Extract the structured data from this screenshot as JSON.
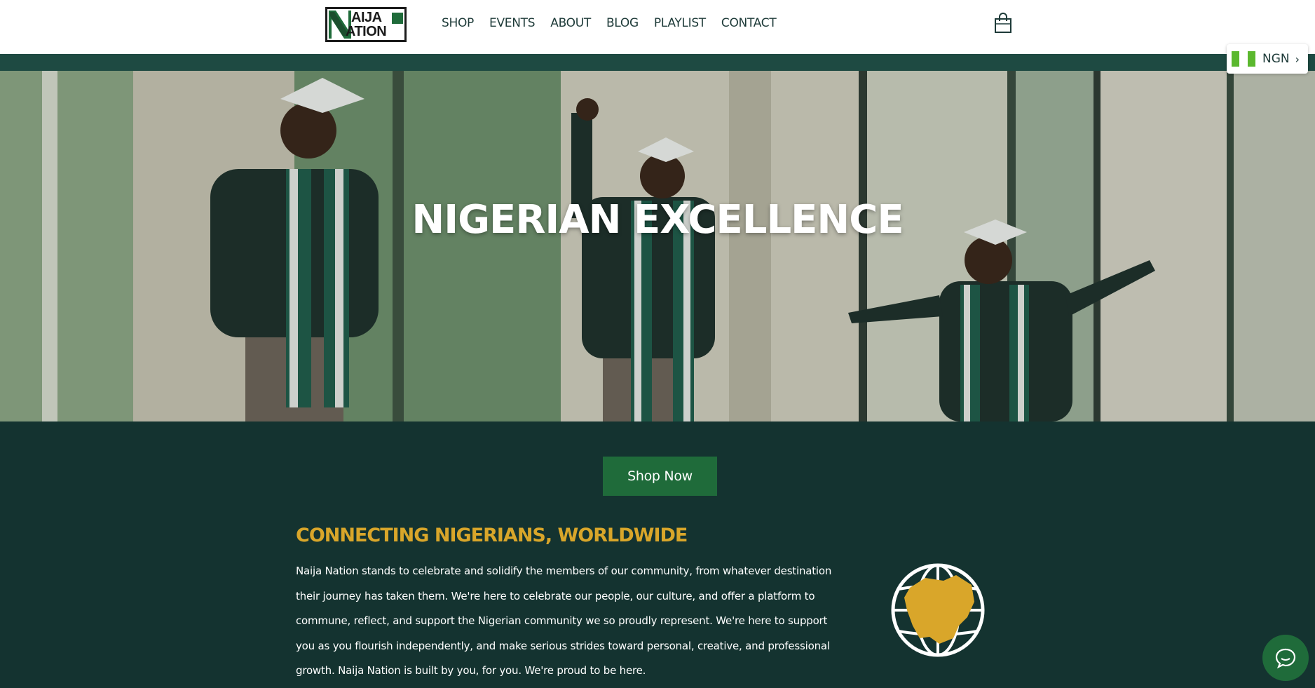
{
  "header": {
    "logo": {
      "line1": "AIJA",
      "line2": "ATION",
      "alt": "Naija Nation"
    },
    "nav": [
      "SHOP",
      "EVENTS",
      "ABOUT",
      "BLOG",
      "PLAYLIST",
      "CONTACT"
    ],
    "cart_icon": "shopping-bag-icon"
  },
  "currency": {
    "code": "NGN",
    "flag": "nigeria-flag-icon",
    "flag_colors": [
      "#5bb82e",
      "#ffffff",
      "#5bb82e"
    ]
  },
  "hero": {
    "title": "NIGERIAN EXCELLENCE"
  },
  "cta": {
    "label": "Shop Now"
  },
  "about": {
    "heading": "CONNECTING NIGERIANS, WORLDWIDE",
    "body": "Naija Nation stands to celebrate and solidify the members of our community, from whatever destination their journey has taken them. We're here to celebrate our people, our culture, and offer a platform to commune, reflect, and support the Nigerian community we so proudly represent. We're here to support you as you flourish independently, and make serious strides toward personal, creative, and professional growth. Naija Nation is built by you, for you. We're proud to be here.",
    "icon": "globe-nigeria-icon"
  },
  "chat": {
    "icon": "chat-bubble-icon"
  },
  "colors": {
    "dark_teal": "#143330",
    "brand_green": "#1f6b3a",
    "gold": "#d9a62a",
    "band": "#1e4a42"
  }
}
